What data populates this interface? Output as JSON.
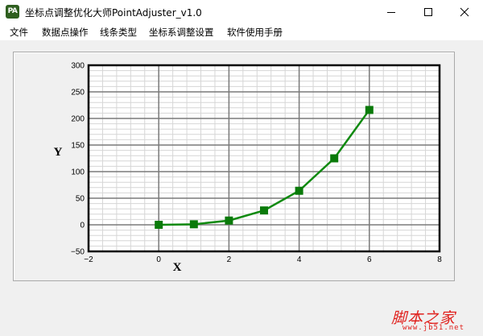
{
  "window": {
    "title": "坐标点调整优化大师PointAdjuster_v1.0",
    "app_icon_text": "PA"
  },
  "menu": {
    "items": [
      {
        "label": "文件"
      },
      {
        "label": "数据点操作"
      },
      {
        "label": "线条类型"
      },
      {
        "label": "坐标系调整设置"
      },
      {
        "label": "软件使用手册"
      }
    ]
  },
  "colors": {
    "series": "#0f8a0f",
    "marker": "#0a7a0a",
    "grid_major": "#7a7a7a",
    "grid_minor": "#d6d6d6",
    "plot_border": "#000000",
    "watermark": "#e0201c"
  },
  "chart_data": {
    "type": "line",
    "title": "",
    "xlabel": "X",
    "ylabel": "Y",
    "xlim": [
      -2,
      8
    ],
    "ylim": [
      -50,
      300
    ],
    "x_ticks": [
      -2,
      0,
      2,
      4,
      6,
      8
    ],
    "y_ticks": [
      -50,
      0,
      50,
      100,
      150,
      200,
      250,
      300
    ],
    "grid": true,
    "series": [
      {
        "marker": "square",
        "x": [
          0,
          1,
          2,
          3,
          4,
          5,
          6
        ],
        "y": [
          0,
          1,
          8,
          27,
          64,
          125,
          216
        ]
      }
    ]
  },
  "watermark": {
    "main": "脚本之家",
    "sub": "www.jb51.net"
  }
}
